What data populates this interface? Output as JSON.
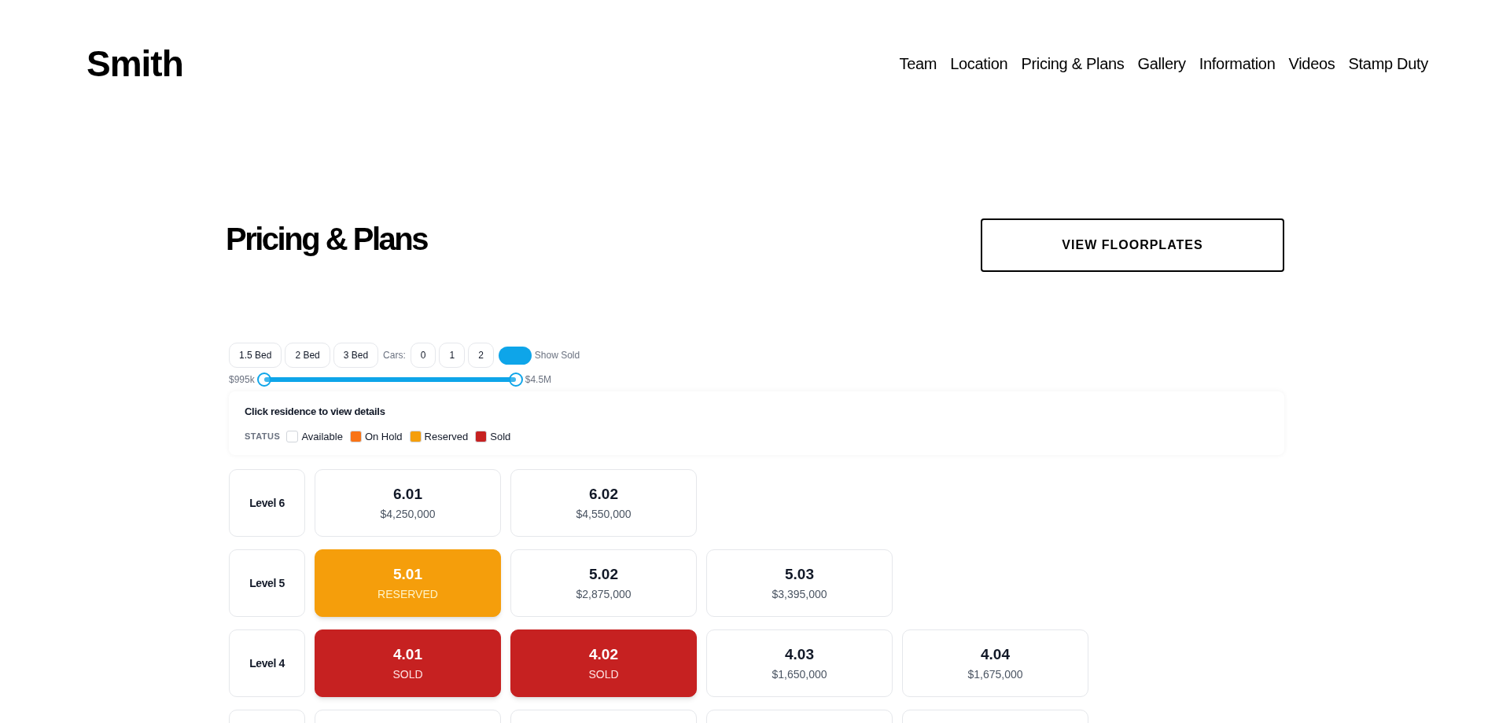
{
  "logo": "Smith",
  "nav": [
    {
      "label": "Team"
    },
    {
      "label": "Location"
    },
    {
      "label": "Pricing & Plans"
    },
    {
      "label": "Gallery"
    },
    {
      "label": "Information"
    },
    {
      "label": "Videos"
    },
    {
      "label": "Stamp Duty"
    }
  ],
  "title": "Pricing & Plans",
  "floorplates_button": "VIEW FLOORPLATES",
  "filters": {
    "beds": [
      {
        "label": "1.5 Bed",
        "selected": false
      },
      {
        "label": "2 Bed",
        "selected": false
      },
      {
        "label": "3 Bed",
        "selected": false
      }
    ],
    "cars_label": "Cars:",
    "cars": [
      {
        "label": "0",
        "selected": false
      },
      {
        "label": "1",
        "selected": false
      },
      {
        "label": "2",
        "selected": false
      }
    ],
    "show_sold": {
      "label": "Show Sold",
      "on": true
    },
    "price_range": {
      "min_label": "$995k",
      "max_label": "$4.5M",
      "low": {
        "level": 0
      },
      "high": {
        "level": 1
      }
    }
  },
  "legend": {
    "hint": "Click residence to view details",
    "status_label": "STATUS",
    "items": [
      {
        "label": "Available",
        "color": "#ffffff"
      },
      {
        "label": "On Hold",
        "color": "#f97316"
      },
      {
        "label": "Reserved",
        "color": "#f59e0b"
      },
      {
        "label": "Sold",
        "color": "#c62121"
      }
    ]
  },
  "levels": [
    {
      "label": "Level 6",
      "units": [
        {
          "number": "6.01",
          "detail": "$4,250,000",
          "kind": "available"
        },
        {
          "number": "6.02",
          "detail": "$4,550,000",
          "kind": "available"
        }
      ]
    },
    {
      "label": "Level 5",
      "units": [
        {
          "number": "5.01",
          "detail": "RESERVED",
          "kind": "reserved"
        },
        {
          "number": "5.02",
          "detail": "$2,875,000",
          "kind": "available"
        },
        {
          "number": "5.03",
          "detail": "$3,395,000",
          "kind": "available"
        }
      ]
    },
    {
      "label": "Level 4",
      "units": [
        {
          "number": "4.01",
          "detail": "SOLD",
          "kind": "sold"
        },
        {
          "number": "4.02",
          "detail": "SOLD",
          "kind": "sold"
        },
        {
          "number": "4.03",
          "detail": "$1,650,000",
          "kind": "available"
        },
        {
          "number": "4.04",
          "detail": "$1,675,000",
          "kind": "available"
        }
      ]
    }
  ]
}
